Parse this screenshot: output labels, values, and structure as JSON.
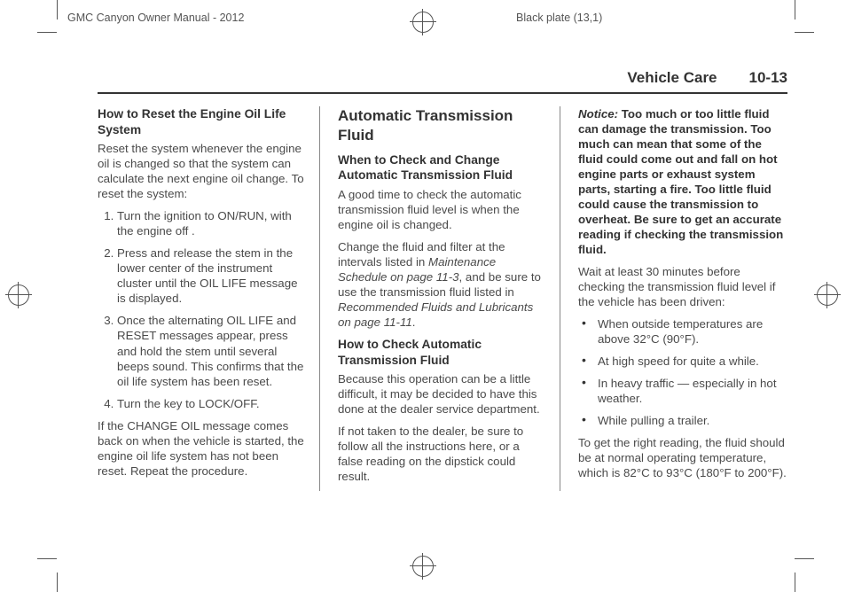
{
  "meta": {
    "manual_title": "GMC Canyon Owner Manual - 2012",
    "plate": "Black plate (13,1)"
  },
  "header": {
    "section": "Vehicle Care",
    "page": "10-13"
  },
  "col1": {
    "h3": "How to Reset the Engine Oil Life System",
    "intro": "Reset the system whenever the engine oil is changed so that the system can calculate the next engine oil change. To reset the system:",
    "steps": [
      "Turn the ignition to ON/RUN, with the engine off .",
      "Press and release the stem in the lower center of the instrument cluster until the OIL LIFE message is displayed.",
      "Once the alternating OIL LIFE and RESET messages appear, press and hold the stem until several beeps sound. This confirms that the oil life system has been reset.",
      "Turn the key to LOCK/OFF."
    ],
    "after": "If the CHANGE OIL message comes back on when the vehicle is started, the engine oil life system has not been reset. Repeat the procedure."
  },
  "col2": {
    "h2": "Automatic Transmission Fluid",
    "sub1": "When to Check and Change Automatic Transmission Fluid",
    "p1": "A good time to check the automatic transmission fluid level is when the engine oil is changed.",
    "p2a": "Change the fluid and filter at the intervals listed in ",
    "p2i1": "Maintenance Schedule on page 11‑3",
    "p2b": ", and be sure to use the transmission fluid listed in ",
    "p2i2": "Recommended Fluids and Lubricants on page 11‑11",
    "p2c": ".",
    "sub2": "How to Check Automatic Transmission Fluid",
    "p3": "Because this operation can be a little difficult, it may be decided to have this done at the dealer service department.",
    "p4": "If not taken to the dealer, be sure to follow all the instructions here, or a false reading on the dipstick could result."
  },
  "col3": {
    "notice_label": "Notice:",
    "notice_body": " Too much or too little fluid can damage the transmission. Too much can mean that some of the fluid could come out and fall on hot engine parts or exhaust system parts, starting a fire. Too little fluid could cause the transmission to overheat. Be sure to get an accurate reading if checking the transmission fluid.",
    "wait": "Wait at least 30 minutes before checking the transmission fluid level if the vehicle has been driven:",
    "bullets": [
      "When outside temperatures are above 32°C (90°F).",
      "At high speed for quite a while.",
      "In heavy traffic — especially in hot weather.",
      "While pulling a trailer."
    ],
    "closing": "To get the right reading, the fluid should be at normal operating temperature, which is 82°C to 93°C (180°F to 200°F)."
  }
}
